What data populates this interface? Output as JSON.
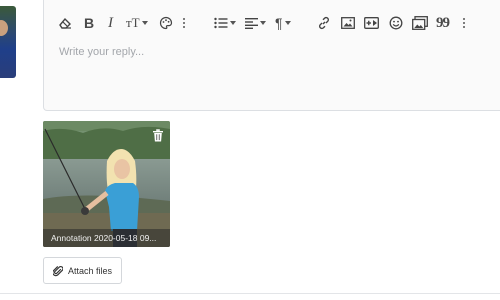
{
  "editor": {
    "placeholder": "Write your reply..."
  },
  "toolbar": {
    "buttons": [
      {
        "icon": "eraser-icon"
      },
      {
        "icon": "bold-icon",
        "label": "B"
      },
      {
        "icon": "italic-icon",
        "label": "I"
      },
      {
        "icon": "font-size-icon",
        "label": "тT"
      },
      {
        "icon": "palette-icon"
      },
      {
        "icon": "more-vertical-icon"
      },
      {
        "icon": "list-icon"
      },
      {
        "icon": "align-left-icon"
      },
      {
        "icon": "paragraph-icon",
        "label": "¶"
      },
      {
        "icon": "link-icon"
      },
      {
        "icon": "image-icon"
      },
      {
        "icon": "media-icon"
      },
      {
        "icon": "smiley-icon"
      },
      {
        "icon": "gallery-icon"
      },
      {
        "icon": "quote-icon",
        "label": "99"
      },
      {
        "icon": "more-vertical-icon"
      }
    ]
  },
  "attachment": {
    "filename": "Annotation 2020-05-18 09..."
  },
  "attach_button": {
    "label": "Attach files"
  }
}
